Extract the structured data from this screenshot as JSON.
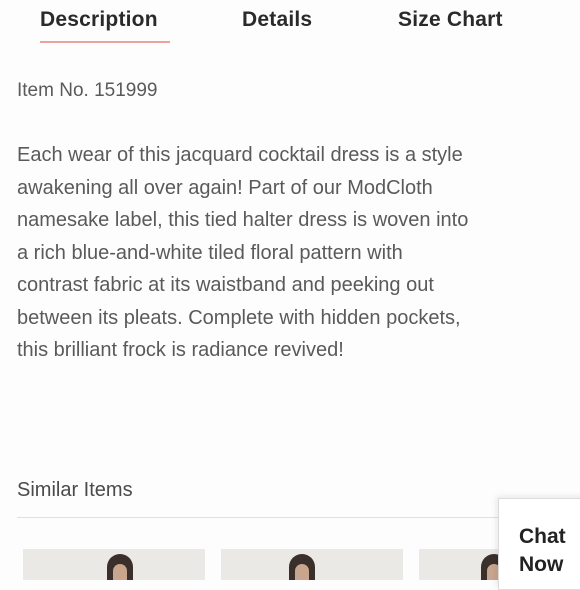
{
  "tabs": {
    "description": "Description",
    "details": "Details",
    "size_chart": "Size Chart",
    "active_underline_color": "#e9a39a"
  },
  "item_number": "Item No. 151999",
  "description_lines": [
    "Each wear of this jacquard cocktail dress is a style",
    "awakening all over again! Part of our ModCloth",
    "namesake label, this tied halter dress is woven into",
    "a rich blue-and-white tiled floral pattern with",
    "contrast fabric at its waistband and peeking out",
    "between its pleats. Complete with hidden pockets,",
    "this brilliant frock is radiance revived!"
  ],
  "similar_items": {
    "title": "Similar Items"
  },
  "chat": {
    "line1": "Chat",
    "line2": "Now"
  }
}
